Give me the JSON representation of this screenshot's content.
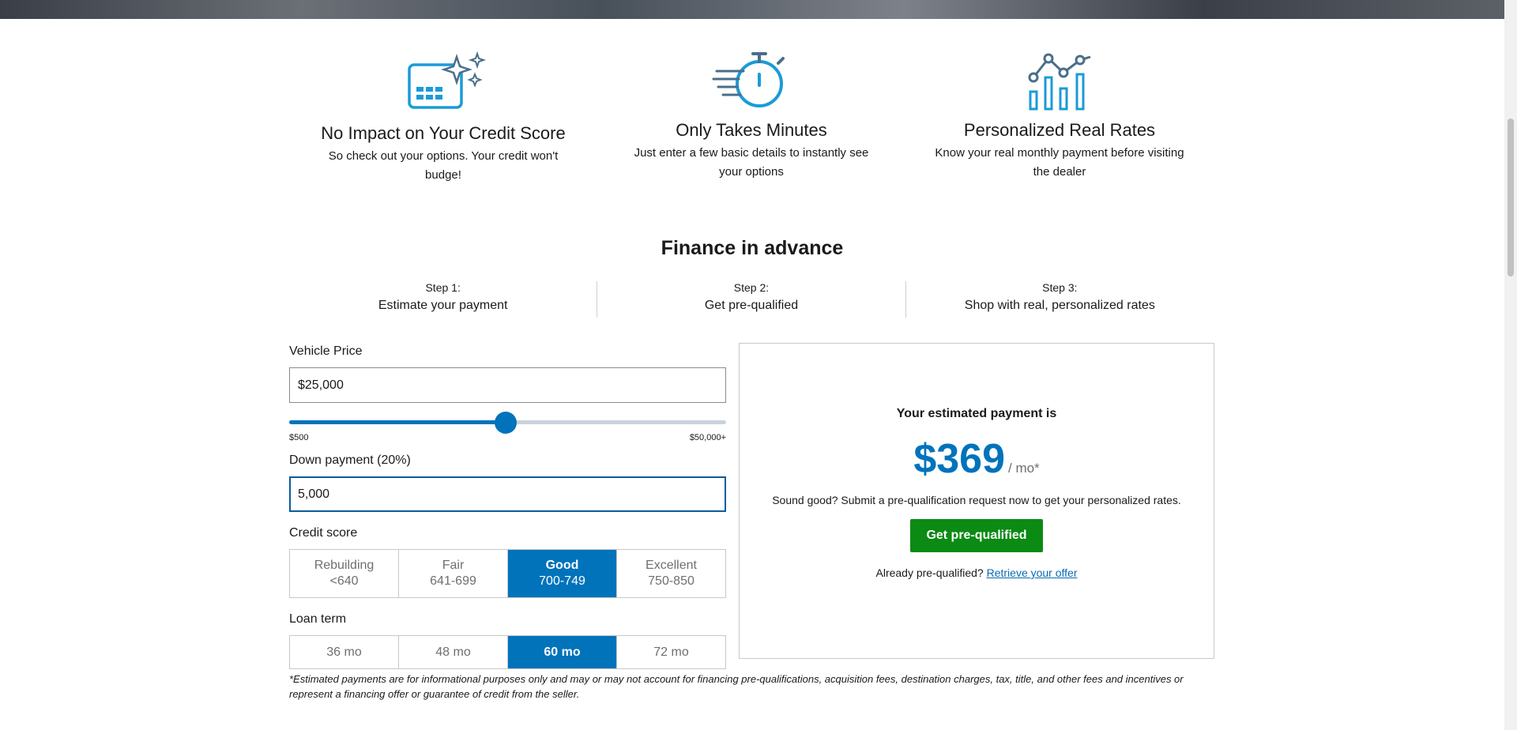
{
  "features": [
    {
      "icon": "credit-card-sparkle-icon",
      "title": "No Impact on Your Credit Score",
      "desc": "So check out your options. Your credit won't budge!"
    },
    {
      "icon": "stopwatch-icon",
      "title": "Only Takes Minutes",
      "desc": "Just enter a few basic details to instantly see your options"
    },
    {
      "icon": "bar-chart-trend-icon",
      "title": "Personalized Real Rates",
      "desc": "Know your real monthly payment before visiting the dealer"
    }
  ],
  "section": {
    "title": "Finance in advance"
  },
  "steps": [
    {
      "num": "Step 1:",
      "text": "Estimate your payment"
    },
    {
      "num": "Step 2:",
      "text": "Get pre-qualified"
    },
    {
      "num": "Step 3:",
      "text": "Shop with real, personalized rates"
    }
  ],
  "calculator": {
    "vehicle_price_label": "Vehicle Price",
    "vehicle_price_value": "$25,000",
    "slider": {
      "min_label": "$500",
      "max_label": "$50,000+",
      "level": 0.4949
    },
    "down_payment_label": "Down payment (20%)",
    "down_payment_value": "5,000",
    "credit_label": "Credit score",
    "credit_options": [
      {
        "l1": "Rebuilding",
        "l2": "<640"
      },
      {
        "l1": "Fair",
        "l2": "641-699"
      },
      {
        "l1": "Good",
        "l2": "700-749"
      },
      {
        "l1": "Excellent",
        "l2": "750-850"
      }
    ],
    "credit_selected": 2,
    "term_label": "Loan term",
    "term_options": [
      "36 mo",
      "48 mo",
      "60 mo",
      "72 mo"
    ],
    "term_selected": 2
  },
  "result": {
    "headline": "Your estimated payment is",
    "amount": "$369",
    "per": "/ mo*",
    "cta_text": "Sound good? Submit a pre-qualification request now to get your personalized rates.",
    "button_label": "Get pre-qualified",
    "already_text": "Already pre-qualified?",
    "retrieve_link": "Retrieve your offer"
  },
  "disclaimer": "*Estimated payments are for informational purposes only and may or may not account for financing pre-qualifications, acquisition fees, destination charges, tax, title, and other fees and incentives or represent a financing offer or guarantee of credit from the seller.",
  "colors": {
    "accent": "#0073bb",
    "cta": "#0b8a14",
    "link": "#0a6bb0",
    "icon": "#1a9bd7"
  }
}
